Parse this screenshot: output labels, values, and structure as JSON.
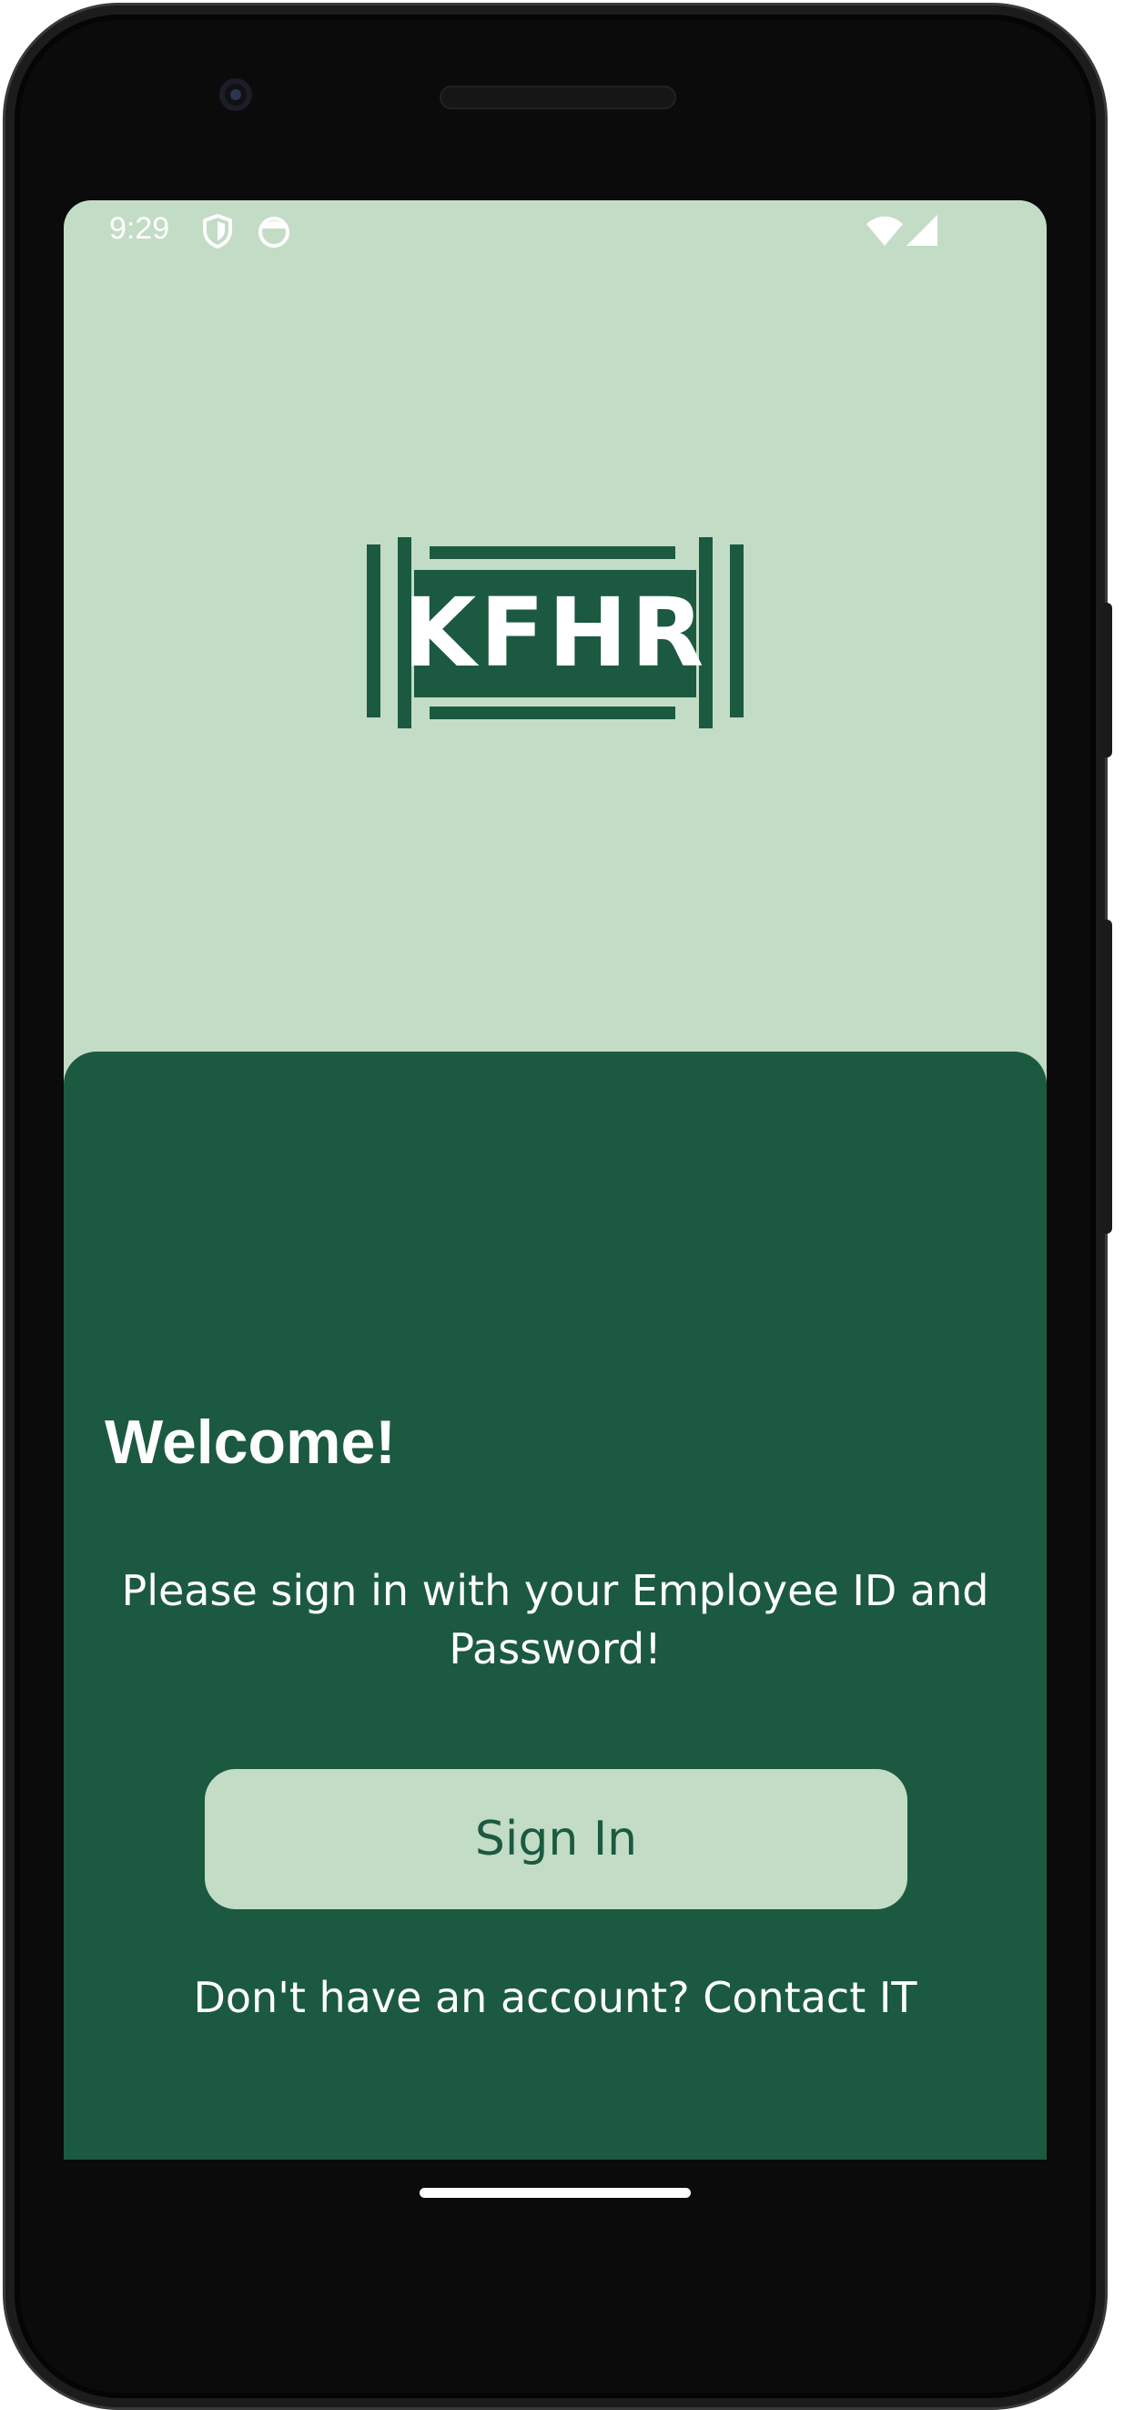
{
  "status_bar": {
    "time": "9:29",
    "icons": [
      "shield-icon",
      "face-icon",
      "wifi-icon",
      "cell-signal-icon"
    ]
  },
  "logo": {
    "text": "KFHR"
  },
  "colors": {
    "brand_dark_green": "#1b5a40",
    "brand_light_green": "#c3dcc6",
    "text_light": "#ffffff"
  },
  "login": {
    "title": "Welcome!",
    "prompt": "Please sign in with your Employee ID and Password!",
    "signin_label": "Sign In",
    "contact_text": "Don't have an account? Contact IT"
  }
}
